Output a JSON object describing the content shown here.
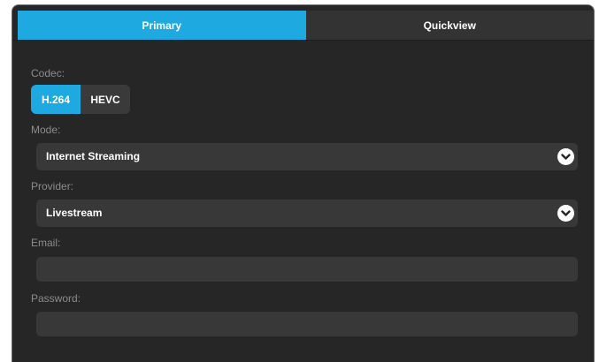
{
  "tabs": {
    "primary": "Primary",
    "quickview": "Quickview"
  },
  "codec": {
    "label": "Codec:",
    "options": [
      "H.264",
      "HEVC"
    ],
    "selected": "H.264"
  },
  "mode": {
    "label": "Mode:",
    "value": "Internet Streaming"
  },
  "provider": {
    "label": "Provider:",
    "value": "Livestream"
  },
  "email": {
    "label": "Email:",
    "value": "",
    "placeholder": ""
  },
  "password": {
    "label": "Password:",
    "value": "",
    "placeholder": ""
  },
  "colors": {
    "accent": "#1fa9e1",
    "panel": "#262626",
    "field": "#383838",
    "label": "#8c8c8c"
  },
  "icons": {
    "dropdown": "chevron-down-icon"
  }
}
